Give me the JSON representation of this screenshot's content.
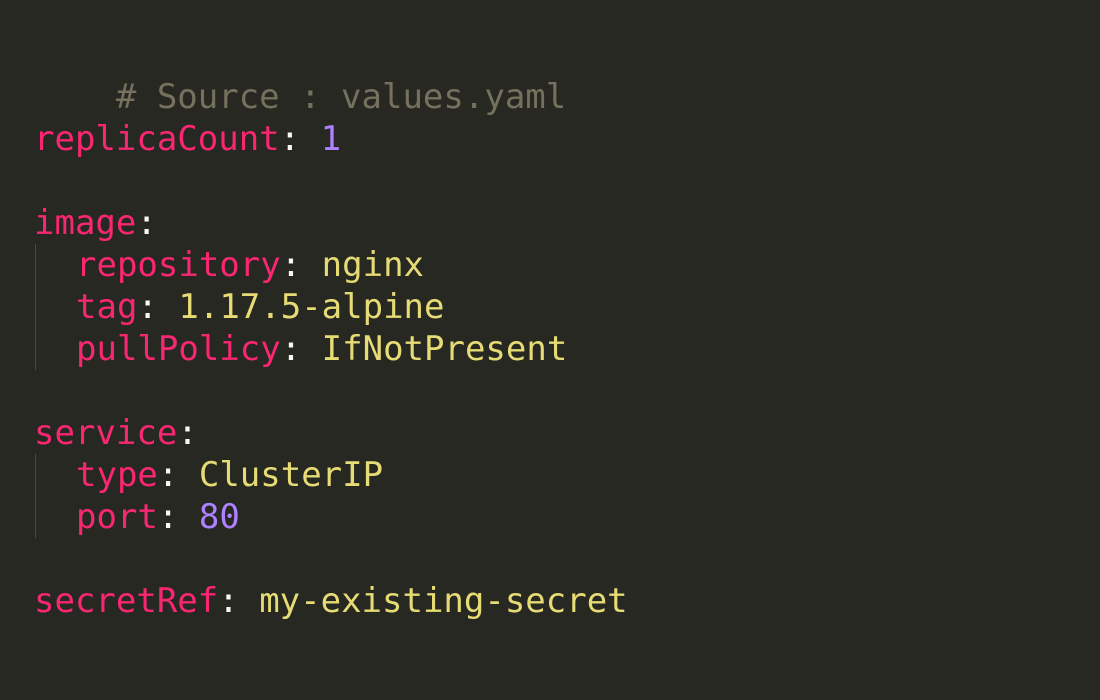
{
  "editor": {
    "comment": "# Source : values.yaml",
    "replicaCount": {
      "key": "replicaCount",
      "value": "1"
    },
    "image": {
      "key": "image",
      "repository": {
        "key": "repository",
        "value": "nginx"
      },
      "tag": {
        "key": "tag",
        "value": "1.17.5-alpine"
      },
      "pullPolicy": {
        "key": "pullPolicy",
        "value": "IfNotPresent"
      }
    },
    "service": {
      "key": "service",
      "type": {
        "key": "type",
        "value": "ClusterIP"
      },
      "port": {
        "key": "port",
        "value": "80"
      }
    },
    "secretRef": {
      "key": "secretRef",
      "value": "my-existing-secret"
    },
    "colors": {
      "background": "#272822",
      "comment": "#75715e",
      "key": "#f92672",
      "number": "#ae81ff",
      "string": "#e6db74",
      "punctuation": "#f8f8f2"
    }
  }
}
